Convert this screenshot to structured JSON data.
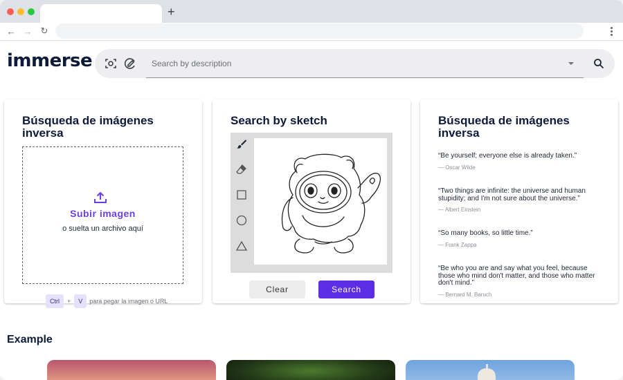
{
  "browser": {
    "new_tab_symbol": "+",
    "back_symbol": "←",
    "forward_symbol": "→",
    "reload_symbol": "↻"
  },
  "header": {
    "logo": "immerse",
    "search_placeholder": "Search by description",
    "icons": [
      "camera-scan-icon",
      "sketch-search-icon",
      "dropdown-caret-icon",
      "search-icon"
    ]
  },
  "reverse_card": {
    "title": "Búsqueda de imágenes inversa",
    "upload_label": "Subir imagen",
    "upload_sub": "o suelta un archivo aquí",
    "paste_key1": "Ctrl",
    "paste_plus": "+",
    "paste_key2": "V",
    "paste_hint": "para pegar la imagen o URL"
  },
  "sketch_card": {
    "title": "Search by sketch",
    "tools": [
      "brush-icon",
      "eraser-icon",
      "square-icon",
      "circle-icon",
      "triangle-icon"
    ],
    "clear_label": "Clear",
    "search_label": "Search"
  },
  "quotes_card": {
    "title": "Búsqueda de imágenes inversa",
    "quotes": [
      {
        "text": "“Be yourself; everyone else is already taken.”",
        "author": "— Oscar Wilde"
      },
      {
        "text": "“Two things are infinite: the universe and human stupidity; and I'm not sure about the universe.”",
        "author": "— Albert Einstein"
      },
      {
        "text": "“So many books, so little time.”",
        "author": "— Frank Zappa"
      },
      {
        "text": "“Be who you are and say what you feel, because those who mind don't matter, and those who matter don't mind.”",
        "author": "— Bernard M. Baruch"
      }
    ]
  },
  "examples": {
    "title": "Example"
  },
  "colors": {
    "accent": "#5b2ee6",
    "logo": "#0e1a3a"
  }
}
